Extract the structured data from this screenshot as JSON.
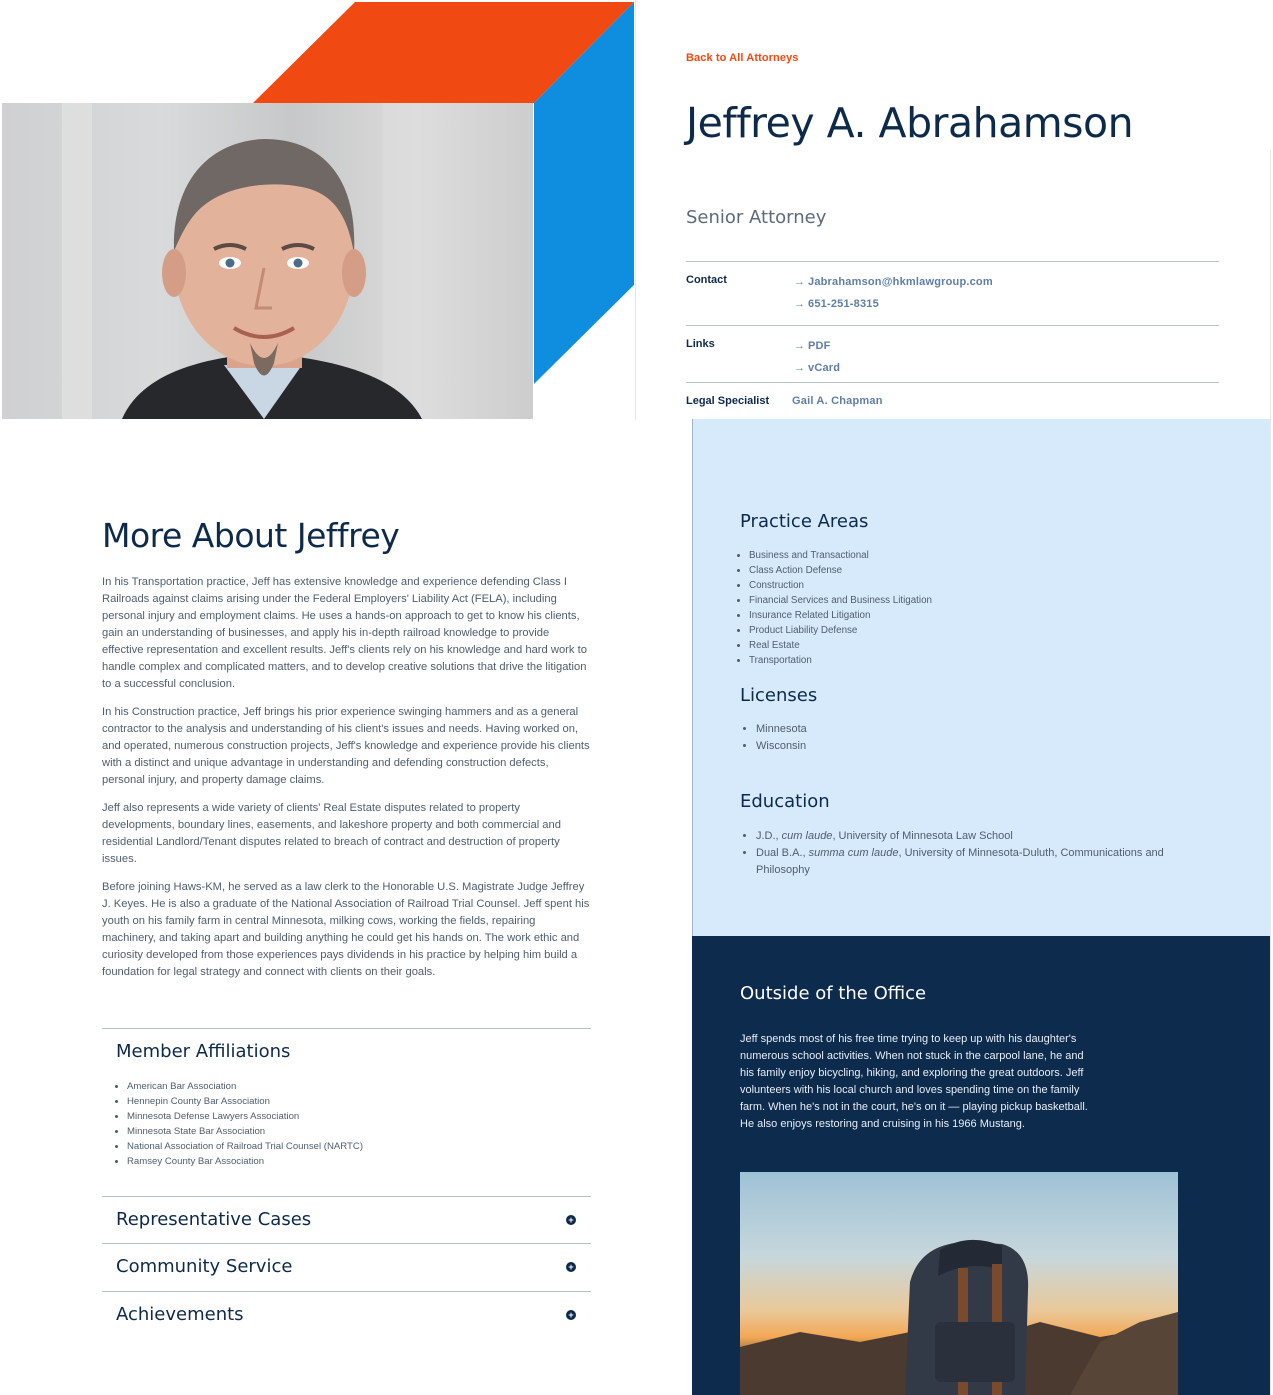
{
  "hero": {
    "back_link": "Back to All Attorneys",
    "name": "Jeffrey A. Abrahamson",
    "title": "Senior Attorney",
    "colors": {
      "orange": "#f04a12",
      "blue": "#0f8ee0",
      "navy": "#0c2b4d"
    }
  },
  "info": {
    "contact_label": "Contact",
    "email": "Jabrahamson@hkmlawgroup.com",
    "phone": "651-251-8315",
    "links_label": "Links",
    "pdf": "PDF",
    "vcard": "vCard",
    "specialist_label": "Legal Specialist",
    "specialist_name": "Gail A. Chapman",
    "arrow_icon": "→"
  },
  "about": {
    "heading": "More About Jeffrey",
    "paragraphs": [
      "In his Transportation practice, Jeff has extensive knowledge and experience defending Class I Railroads against claims arising under the Federal Employers' Liability Act (FELA), including personal injury and employment claims. He uses a hands-on approach to get to know his clients, gain an understanding of businesses, and apply his in-depth railroad knowledge to provide effective representation and excellent results. Jeff's clients rely on his knowledge and hard work to handle complex and complicated matters, and to develop creative solutions that drive the litigation to a successful conclusion.",
      "In his Construction practice, Jeff brings his prior experience swinging hammers and as a general contractor to the analysis and understanding of his client's issues and needs. Having worked on, and operated, numerous construction projects, Jeff's knowledge and experience provide his clients with a distinct and unique advantage in understanding and defending construction defects, personal injury, and property damage claims.",
      "Jeff also represents a wide variety of clients' Real Estate disputes related to property developments, boundary lines, easements, and lakeshore property and both commercial and residential Landlord/Tenant disputes related to breach of contract and destruction of property issues.",
      "Before joining Haws-KM, he served as a law clerk to the Honorable U.S. Magistrate Judge Jeffrey J. Keyes. He is also a graduate of the National Association of Railroad Trial Counsel. Jeff spent his youth on his family farm in central Minnesota, milking cows, working the fields, repairing machinery, and taking apart and building anything he could get his hands on. The work ethic and curiosity developed from those experiences pays dividends in his practice by helping him build a foundation for legal strategy and connect with clients on their goals."
    ]
  },
  "affiliations": {
    "heading": "Member Affiliations",
    "items": [
      "American Bar Association",
      "Hennepin County Bar Association",
      "Minnesota Defense Lawyers Association",
      "Minnesota State Bar Association",
      "National Association of Railroad Trial Counsel (NARTC)",
      "Ramsey County Bar Association"
    ]
  },
  "accordions": [
    "Representative Cases",
    "Community Service",
    "Achievements"
  ],
  "practice": {
    "heading": "Practice Areas",
    "items": [
      "Business and Transactional",
      "Class Action Defense",
      "Construction",
      "Financial Services and Business Litigation",
      "Insurance Related Litigation",
      "Product Liability Defense",
      "Real Estate",
      "Transportation"
    ]
  },
  "licenses": {
    "heading": "Licenses",
    "items": [
      "Minnesota",
      "Wisconsin"
    ]
  },
  "education": {
    "heading": "Education",
    "items": [
      {
        "pre": "J.D., ",
        "honor": "cum laude",
        "post": ", University of Minnesota Law School"
      },
      {
        "pre": "Dual B.A., ",
        "honor": "summa cum laude",
        "post": ", University of Minnesota-Duluth, Communications and Philosophy"
      }
    ]
  },
  "outside": {
    "heading": "Outside of the Office",
    "text": "Jeff spends most of his free time trying to keep up with his daughter's numerous school activities. When not stuck in the carpool lane, he and his family enjoy bicycling, hiking, and exploring the great outdoors. Jeff volunteers with his local church and loves spending time on the family farm. When he's not in the court, he's on it — playing pickup basketball. He also enjoys restoring and cruising in his 1966 Mustang."
  }
}
